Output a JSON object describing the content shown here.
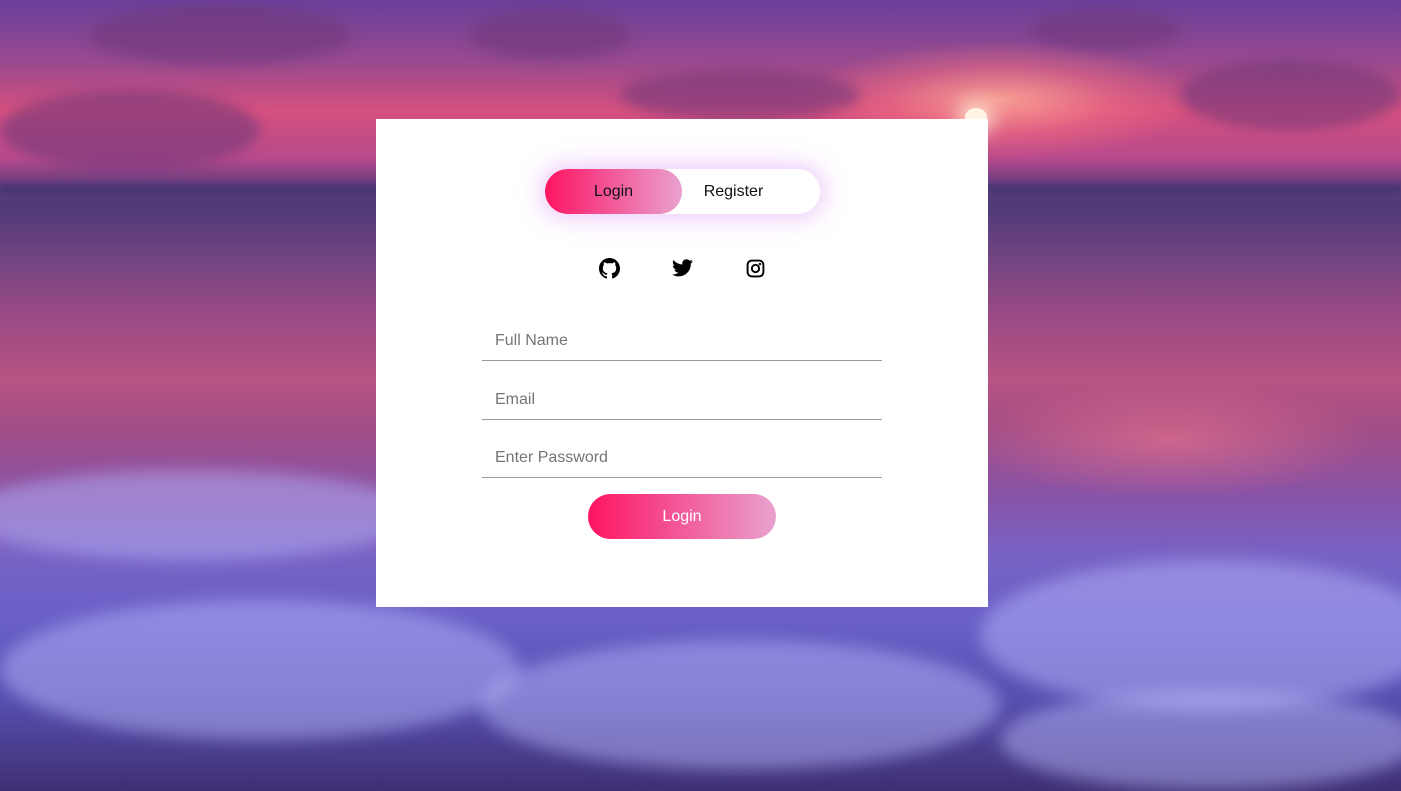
{
  "toggle": {
    "login_label": "Login",
    "register_label": "Register",
    "active": "login"
  },
  "social": [
    {
      "icon": "github-icon"
    },
    {
      "icon": "twitter-icon"
    },
    {
      "icon": "instagram-icon"
    }
  ],
  "form": {
    "full_name_placeholder": "Full Name",
    "email_placeholder": "Email",
    "password_placeholder": "Enter Password",
    "full_name_value": "",
    "email_value": "",
    "password_value": "",
    "submit_label": "Login"
  },
  "colors": {
    "accent_start": "#ff1461",
    "accent_end": "#e9a2cf",
    "card_bg": "#ffffff"
  }
}
